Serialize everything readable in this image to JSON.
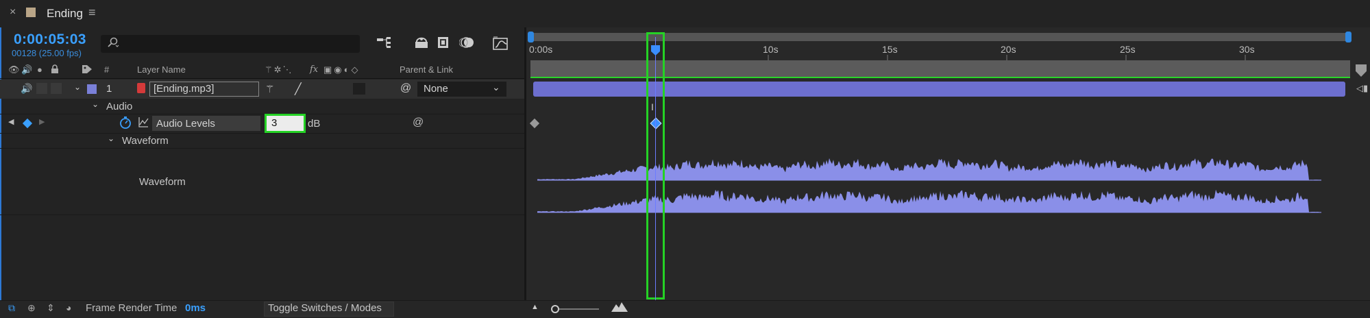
{
  "tab": {
    "close": "×",
    "title": "Ending",
    "menu": "≡"
  },
  "timecode": "0:00:05:03",
  "frame_info": "00128 (25.00 fps)",
  "search": {
    "icon": "search-icon",
    "placeholder": ""
  },
  "columns": {
    "number": "#",
    "layer_name": "Layer Name",
    "parent_link": "Parent & Link",
    "fx": "fx"
  },
  "layer": {
    "index": "1",
    "name": "[Ending.mp3]",
    "parent": "None",
    "label_color": "#7a80d8"
  },
  "properties": {
    "audio_group": "Audio",
    "audio_levels_label": "Audio Levels",
    "audio_levels_value": "3",
    "audio_levels_unit": "dB",
    "waveform_group": "Waveform",
    "waveform_label": "Waveform"
  },
  "bottom": {
    "frame_render_time_label": "Frame Render Time",
    "frame_render_time_value": "0ms",
    "toggle_label": "Toggle Switches / Modes"
  },
  "ruler": {
    "ticks": [
      "0:00s",
      "10s",
      "15s",
      "20s",
      "25s",
      "30s"
    ]
  },
  "colors": {
    "accent": "#3aa0ff",
    "highlight": "#25d225",
    "waveform": "#8a8fe8",
    "audio_bar": "#6d6fcf"
  }
}
